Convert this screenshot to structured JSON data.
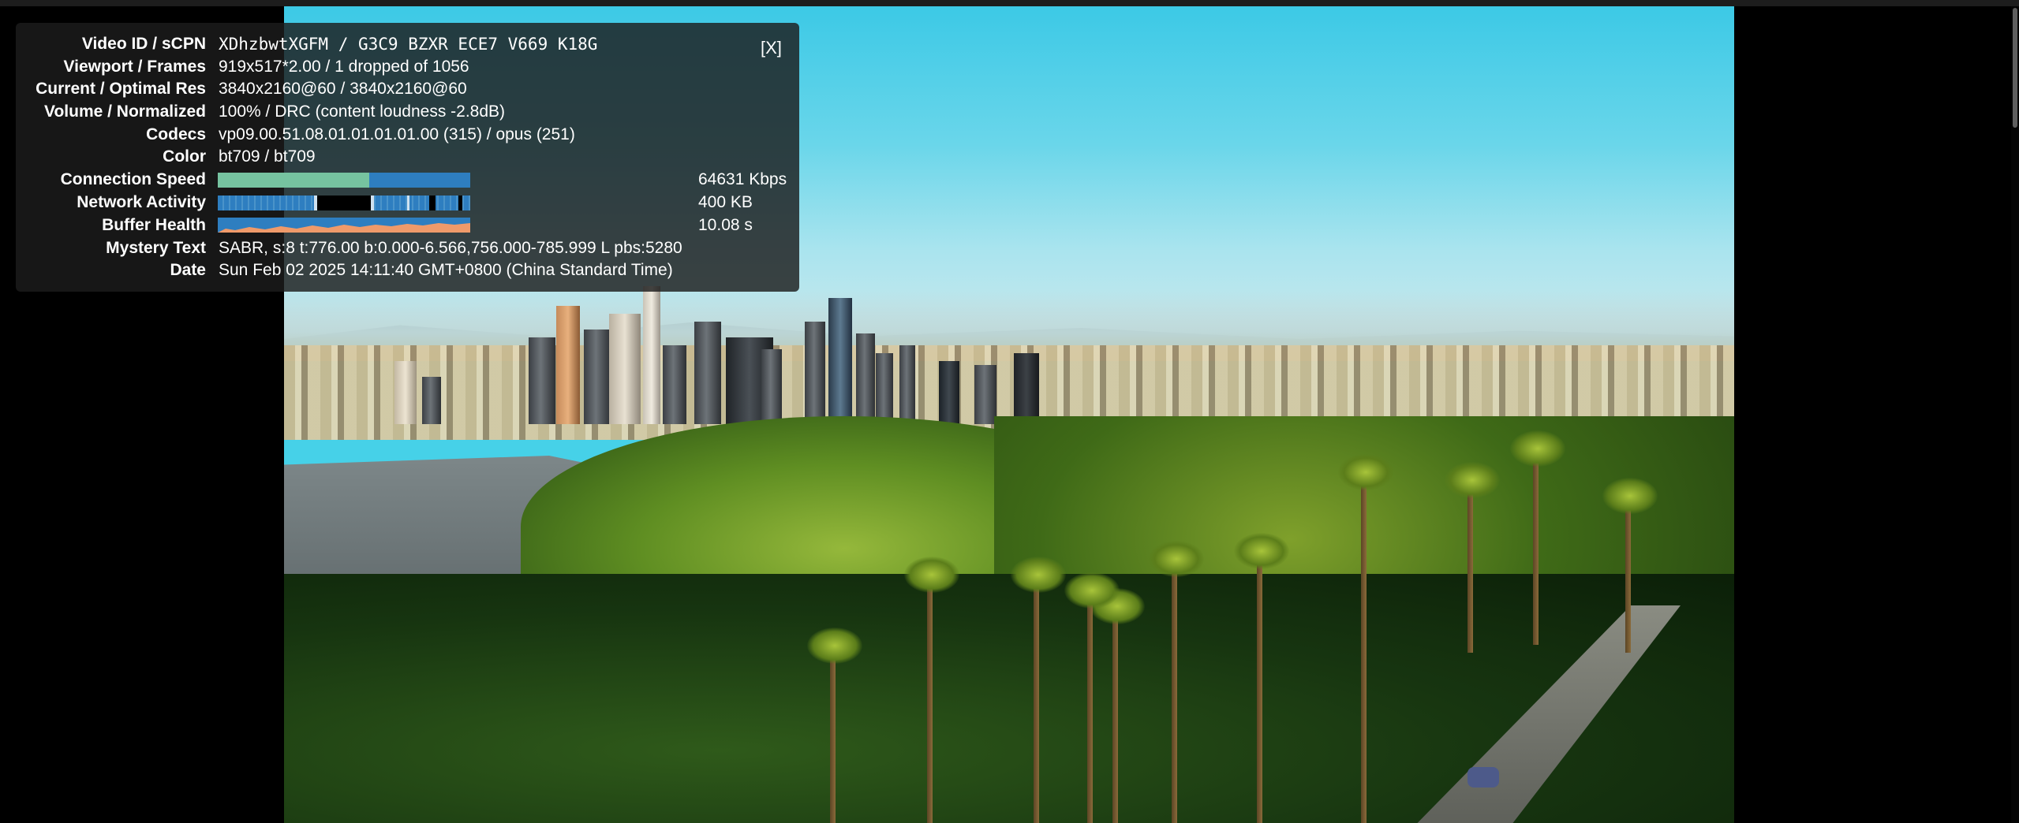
{
  "stats": {
    "close_label": "[X]",
    "rows": [
      {
        "label": "Video ID / sCPN",
        "value": "XDhzbwtXGFM / G3C9 BZXR ECE7 V669 K18G"
      },
      {
        "label": "Viewport / Frames",
        "value": "919x517*2.00 / 1 dropped of 1056"
      },
      {
        "label": "Current / Optimal Res",
        "value": "3840x2160@60 / 3840x2160@60"
      },
      {
        "label": "Volume / Normalized",
        "value": "100% / DRC (content loudness -2.8dB)"
      },
      {
        "label": "Codecs",
        "value": "vp09.00.51.08.01.01.01.01.00 (315) / opus (251)"
      },
      {
        "label": "Color",
        "value": "bt709 / bt709"
      },
      {
        "label": "Connection Speed",
        "value": "64631 Kbps"
      },
      {
        "label": "Network Activity",
        "value": "400 KB"
      },
      {
        "label": "Buffer Health",
        "value": "10.08 s"
      },
      {
        "label": "Mystery Text",
        "value": "SABR, s:8 t:776.00 b:0.000-6.566,756.000-785.999 L pbs:5280"
      },
      {
        "label": "Date",
        "value": "Sun Feb 02 2025 14:11:40 GMT+0800 (China Standard Time)"
      }
    ],
    "connection_speed_fill": 0.6,
    "colors": {
      "panel_bg": "#1c1c1c",
      "bar_bg": "#2e7ec0",
      "connection_fill": "#76c3a0",
      "buffer_fill": "#ef9a6a"
    }
  }
}
